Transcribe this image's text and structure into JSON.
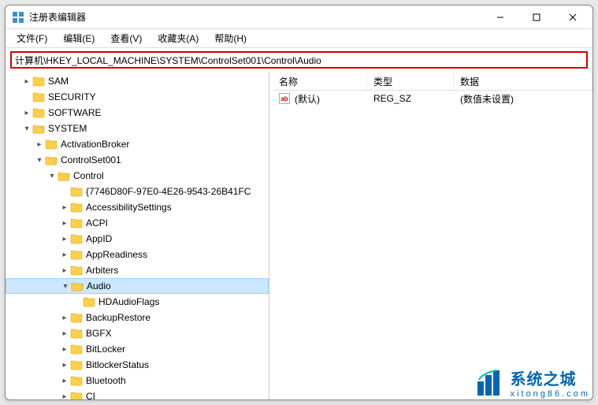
{
  "window": {
    "title": "注册表编辑器"
  },
  "menu": {
    "file": "文件(F)",
    "edit": "编辑(E)",
    "view": "查看(V)",
    "favorites": "收藏夹(A)",
    "help": "帮助(H)"
  },
  "address": {
    "value": "计算机\\HKEY_LOCAL_MACHINE\\SYSTEM\\ControlSet001\\Control\\Audio"
  },
  "tree": {
    "sam": "SAM",
    "security": "SECURITY",
    "software": "SOFTWARE",
    "system": "SYSTEM",
    "activationbroker": "ActivationBroker",
    "controlset001": "ControlSet001",
    "control": "Control",
    "guidkey": "{7746D80F-97E0-4E26-9543-26B41FC",
    "accessibilitysettings": "AccessibilitySettings",
    "acpi": "ACPI",
    "appid": "AppID",
    "appreadiness": "AppReadiness",
    "arbiters": "Arbiters",
    "audio": "Audio",
    "hdaudioflags": "HDAudioFlags",
    "backuprestore": "BackupRestore",
    "bgfx": "BGFX",
    "bitlocker": "BitLocker",
    "bitlockerstatus": "BitlockerStatus",
    "bluetooth": "Bluetooth",
    "ci": "CI"
  },
  "list": {
    "headers": {
      "name": "名称",
      "type": "类型",
      "data": "数据"
    },
    "rows": [
      {
        "icon": "ab",
        "name": "(默认)",
        "type": "REG_SZ",
        "data": "(数值未设置)"
      }
    ]
  },
  "watermark": {
    "title": "系统之城",
    "sub": "xitong86.com"
  },
  "colors": {
    "address_border": "#d40000",
    "selection": "#cce8ff",
    "folder": "#ffcf4b",
    "brand": "#0066b3"
  }
}
